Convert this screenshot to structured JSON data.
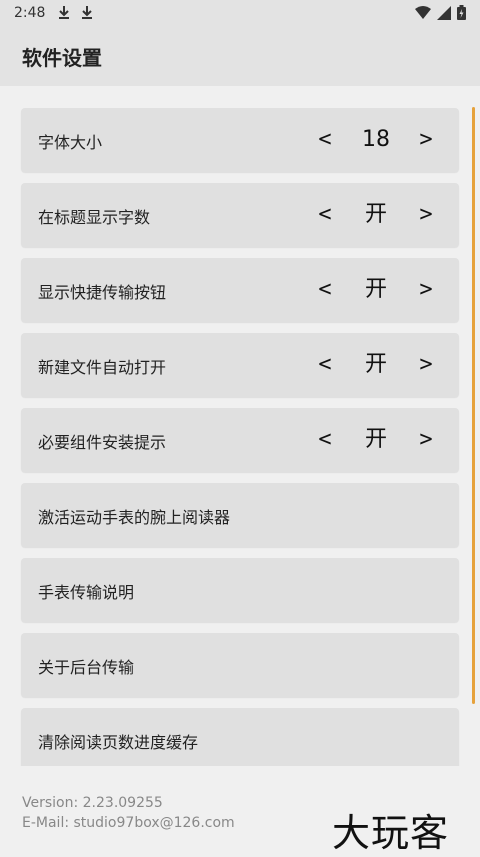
{
  "status_bar": {
    "time": "2:48",
    "icons": [
      "download-icon",
      "download-icon",
      "wifi-icon",
      "signal-icon",
      "battery-icon"
    ]
  },
  "app_bar": {
    "title": "软件设置"
  },
  "settings": [
    {
      "label": "字体大小",
      "value": "18",
      "prev": "<",
      "next": ">"
    },
    {
      "label": "在标题显示字数",
      "value": "开",
      "prev": "<",
      "next": ">"
    },
    {
      "label": "显示快捷传输按钮",
      "value": "开",
      "prev": "<",
      "next": ">"
    },
    {
      "label": "新建文件自动打开",
      "value": "开",
      "prev": "<",
      "next": ">"
    },
    {
      "label": "必要组件安装提示",
      "value": "开",
      "prev": "<",
      "next": ">"
    },
    {
      "label": "激活运动手表的腕上阅读器"
    },
    {
      "label": "手表传输说明"
    },
    {
      "label": "关于后台传输"
    },
    {
      "label": "清除阅读页数进度缓存"
    }
  ],
  "footer": {
    "version": "Version: 2.23.09255",
    "email": "E-Mail: studio97box@126.com"
  },
  "watermark": "大玩客",
  "colors": {
    "accent": "#e6a23c",
    "app_bar": "#e3e3e3",
    "background": "#f0f0f0",
    "card": "#e0e0e0"
  }
}
